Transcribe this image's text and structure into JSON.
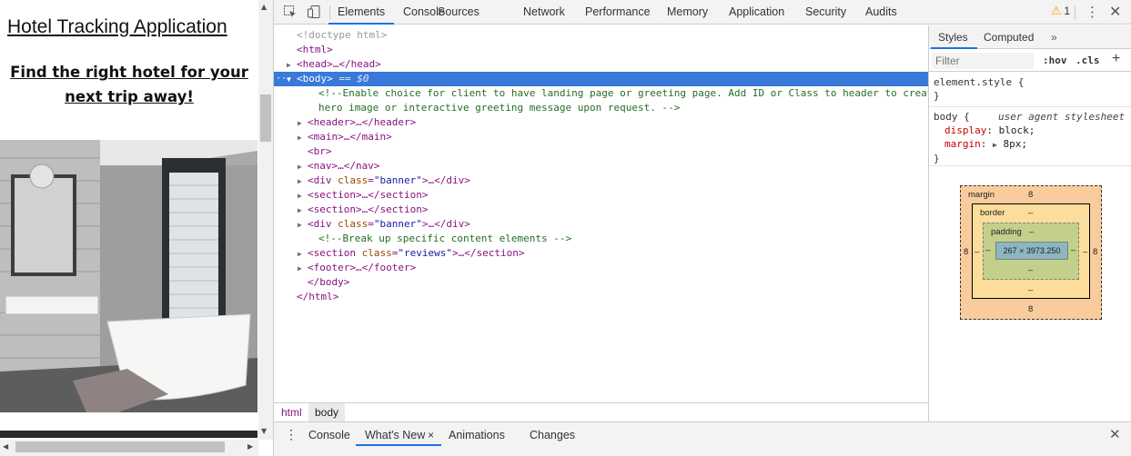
{
  "site": {
    "title": "Hotel Tracking Application",
    "subtitle": "Find the right hotel for your next trip away!",
    "hero_alt": "bathroom-photo"
  },
  "devtools": {
    "tabs": [
      "Elements",
      "Console",
      "Sources",
      "Network",
      "Performance",
      "Memory",
      "Application",
      "Security",
      "Audits"
    ],
    "active_tab": "Elements",
    "warnings_count": "1",
    "dom_lines": [
      {
        "indent": 1,
        "tri": "",
        "text": "<!doctype html>",
        "kind": "doctype"
      },
      {
        "indent": 1,
        "tri": "",
        "text": "<html>",
        "kind": "tag"
      },
      {
        "indent": 1,
        "tri": "▶",
        "text": "<head>…</head>",
        "kind": "tag"
      },
      {
        "indent": 1,
        "tri": "▼",
        "text": "<body>",
        "kind": "tag",
        "selected": true,
        "suffix": "== $0"
      },
      {
        "indent": 2,
        "tri": "",
        "text": "<!--Enable choice for client to have landing page or greeting page. Add ID or Class to header to create",
        "kind": "comment"
      },
      {
        "indent": 2,
        "tri": "",
        "text": "hero image or interactive greeting message upon request. -->",
        "kind": "comment"
      },
      {
        "indent": 2,
        "tri": "▶",
        "text": "<header>…</header>",
        "kind": "tag"
      },
      {
        "indent": 2,
        "tri": "▶",
        "text": "<main>…</main>",
        "kind": "tag"
      },
      {
        "indent": 2,
        "tri": "",
        "text": "<br>",
        "kind": "tag"
      },
      {
        "indent": 2,
        "tri": "▶",
        "text": "<nav>…</nav>",
        "kind": "tag"
      },
      {
        "indent": 2,
        "tri": "▶",
        "text": "<div class=\"banner\">…</div>",
        "kind": "tag"
      },
      {
        "indent": 2,
        "tri": "▶",
        "text": "<section>…</section>",
        "kind": "tag"
      },
      {
        "indent": 2,
        "tri": "▶",
        "text": "<section>…</section>",
        "kind": "tag"
      },
      {
        "indent": 2,
        "tri": "▶",
        "text": "<div class=\"banner\">…</div>",
        "kind": "tag"
      },
      {
        "indent": 2,
        "tri": "",
        "text": "<!--Break up specific content elements -->",
        "kind": "comment"
      },
      {
        "indent": 2,
        "tri": "▶",
        "text": "<section class=\"reviews\">…</section>",
        "kind": "tag"
      },
      {
        "indent": 2,
        "tri": "▶",
        "text": "<footer>…</footer>",
        "kind": "tag"
      },
      {
        "indent": 2,
        "tri": "",
        "text": "</body>",
        "kind": "tag"
      },
      {
        "indent": 1,
        "tri": "",
        "text": "</html>",
        "kind": "tag"
      }
    ],
    "breadcrumb": [
      "html",
      "body"
    ],
    "styles": {
      "tabs": [
        "Styles",
        "Computed"
      ],
      "more": "»",
      "filter_placeholder": "Filter",
      "hov": ":hov",
      "cls": ".cls",
      "add": "+",
      "element_style_open": "element.style {",
      "close_brace": "}",
      "rule_selector": "body {",
      "rule_source": "user agent stylesheet",
      "props": [
        {
          "name": "display",
          "value": "block;"
        },
        {
          "name": "margin",
          "value": "8px;"
        }
      ]
    },
    "box_model": {
      "margin_label": "margin",
      "margin_top": "8",
      "margin_bottom": "8",
      "margin_left": "8",
      "margin_right": "8",
      "border_label": "border",
      "border_value": "–",
      "padding_label": "padding",
      "padding_value": "–",
      "content_size": "267 × 3973.250",
      "dash": "–"
    },
    "drawer": {
      "tabs": [
        "Console",
        "What's New",
        "Animations",
        "Changes"
      ],
      "active_tab": "What's New",
      "close": "×"
    }
  }
}
